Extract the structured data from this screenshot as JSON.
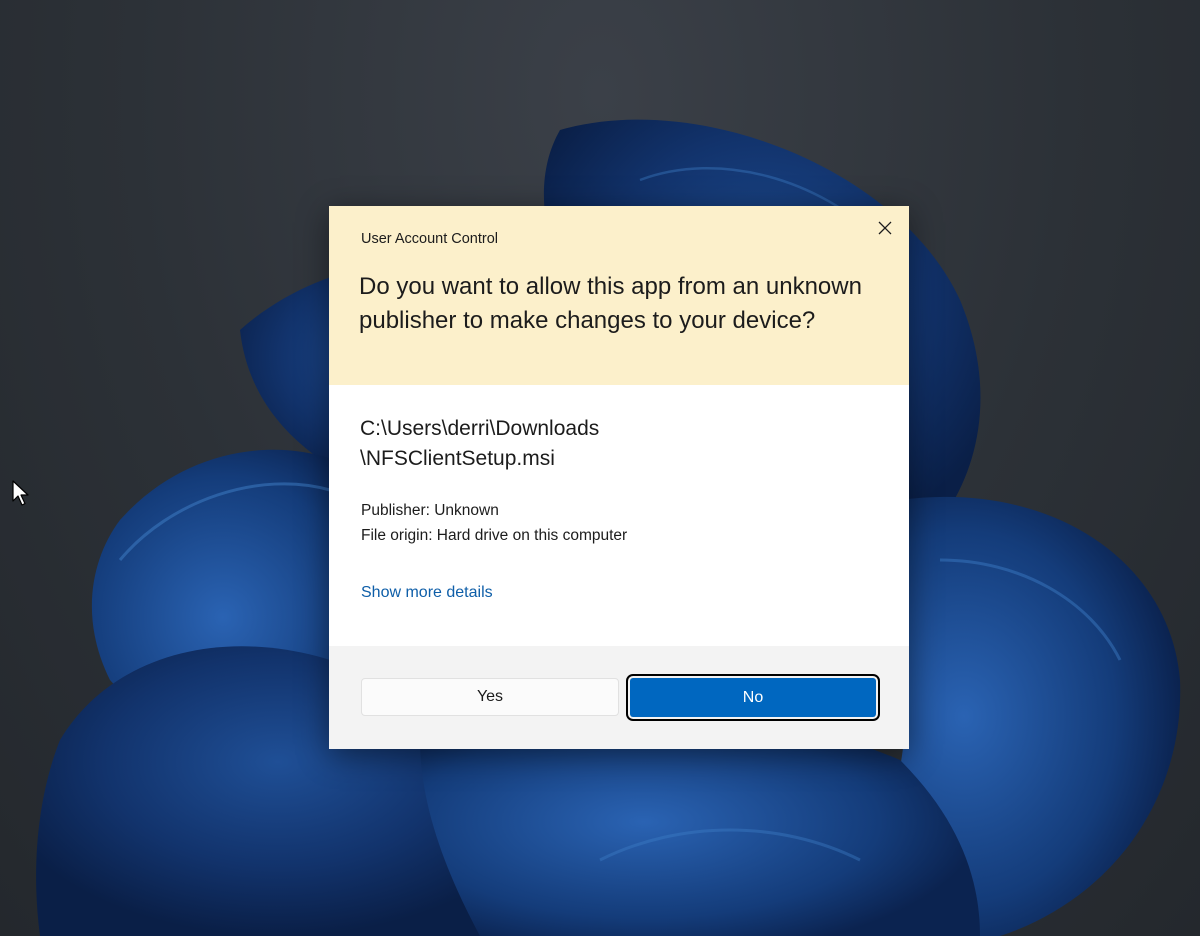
{
  "desktop": {
    "wallpaper_name": "windows-bloom-wallpaper",
    "pointer_icon": "arrow-cursor-icon"
  },
  "uac": {
    "window_title": "User Account Control",
    "close_icon": "close-icon",
    "question": "Do you want to allow this app from an unknown publisher to make changes to your device?",
    "file_path_line1": "C:\\Users\\derri\\Downloads",
    "file_path_line2": "\\NFSClientSetup.msi",
    "publisher": "Publisher: Unknown",
    "file_origin": "File origin: Hard drive on this computer",
    "details_link": "Show more details",
    "yes_label": "Yes",
    "no_label": "No",
    "colors": {
      "header_bg": "#fcf0cb",
      "footer_bg": "#f3f3f3",
      "link": "#0e5ea8",
      "primary_button": "#0067c0"
    }
  }
}
